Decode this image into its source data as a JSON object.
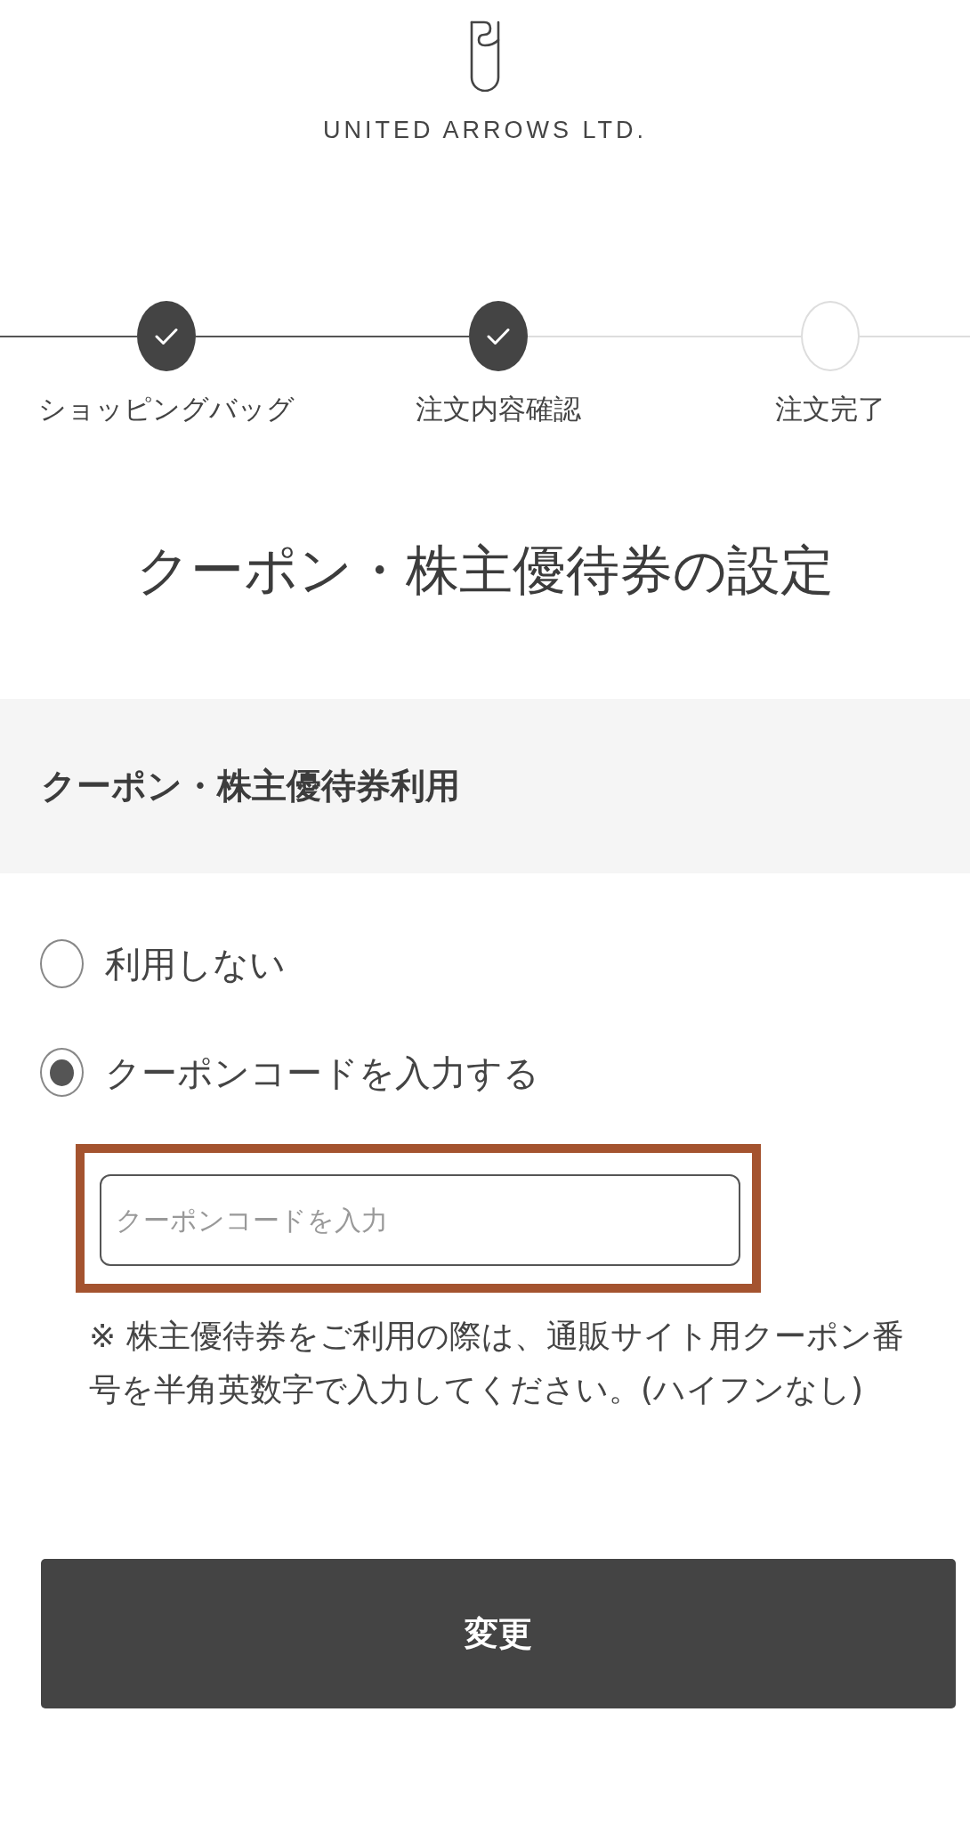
{
  "brand": {
    "name": "UNITED ARROWS LTD."
  },
  "steps": [
    {
      "label": "ショッピングバッグ",
      "completed": true
    },
    {
      "label": "注文内容確認",
      "completed": true
    },
    {
      "label": "注文完了",
      "completed": false
    }
  ],
  "page_title": "クーポン・株主優待券の設定",
  "section": {
    "title": "クーポン・株主優待券利用"
  },
  "options": [
    {
      "label": "利用しない",
      "selected": false
    },
    {
      "label": "クーポンコードを入力する",
      "selected": true
    }
  ],
  "coupon_field": {
    "placeholder": "クーポンコードを入力",
    "highlighted": true
  },
  "note": "※ 株主優待券をご利用の際は、通販サイト用クーポン番号を半角英数字で入力してください。(ハイフンなし)",
  "submit_button": {
    "label": "変更"
  }
}
